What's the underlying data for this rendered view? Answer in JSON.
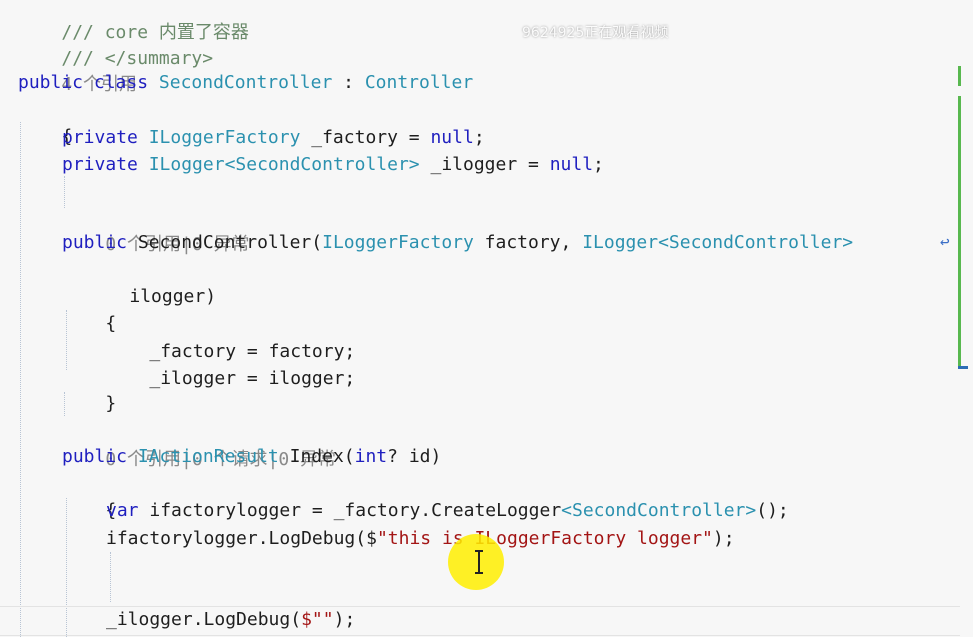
{
  "overlay": {
    "watermark": "9624925正在观看视频"
  },
  "code": {
    "line1": "/// core 内置了容器",
    "line2": "/// </summary>",
    "lens_class": "4 个引用",
    "class_kw_public": "public",
    "class_kw_class": "class",
    "class_name": "SecondController",
    "class_colon": " : ",
    "class_base": "Controller",
    "brace_open": "{",
    "f1_private": "private",
    "f1_type": "ILoggerFactory",
    "f1_rest": " _factory = ",
    "f1_null": "null",
    "f1_end": ";",
    "f2_private": "private",
    "f2_type1": "ILogger",
    "f2_lt": "<",
    "f2_type2": "SecondController",
    "f2_gt": ">",
    "f2_rest": " _ilogger = ",
    "f2_null": "null",
    "f2_end": ";",
    "lens_ctor": "0 个引用|0 异常",
    "ctor_public": "public",
    "ctor_name": " SecondController(",
    "ctor_type1": "ILoggerFactory",
    "ctor_p1": " factory, ",
    "ctor_type2": "ILogger",
    "ctor_lt": "<",
    "ctor_type3": "SecondController",
    "ctor_gt": ">",
    "ctor_cont": "ilogger)",
    "ctor_brace_open": "{",
    "ctor_stmt1": "_factory = factory;",
    "ctor_stmt2": "_ilogger = ilogger;",
    "ctor_brace_close": "}",
    "lens_index": "0 个引用|0 个请求|0 异常",
    "idx_public": "public",
    "idx_type": "IActionResult",
    "idx_name": " Index(",
    "idx_int": "int",
    "idx_rest": "? id)",
    "idx_brace_open": "{",
    "s1_var": "var",
    "s1_rest": " ifactorylogger = _factory.CreateLogger",
    "s1_lt": "<",
    "s1_type": "SecondController",
    "s1_gt": ">",
    "s1_end": "();",
    "s2_start": "ifactorylogger.LogDebug(",
    "s2_dollar": "$",
    "s2_str": "\"this is ILoggerFactory logger\"",
    "s2_end": ");",
    "s3_start": "_ilogger.LogDebug(",
    "s3_dollar": "$",
    "s3_str": "\"\"",
    "s3_end": ");"
  },
  "colors": {
    "keyword": "#1f1fbf",
    "type": "#2b91af",
    "string": "#a31515",
    "codelens": "#8a8a8a",
    "change_bar": "#58b84f",
    "highlight": "#ffee00"
  }
}
